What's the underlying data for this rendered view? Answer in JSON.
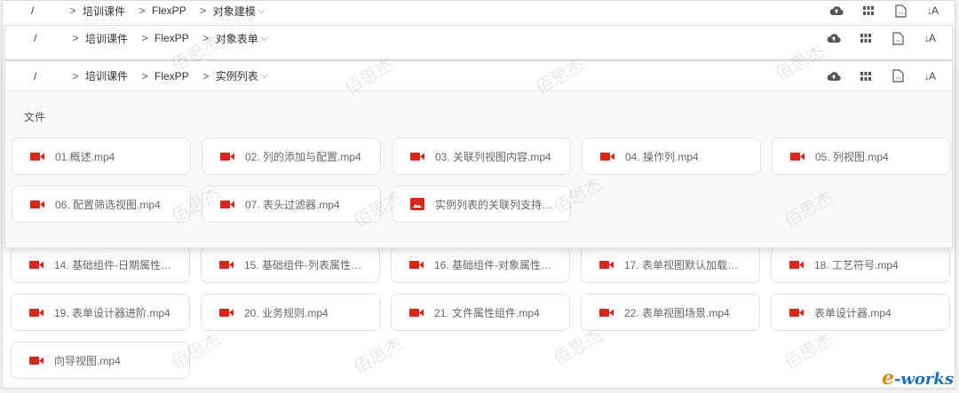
{
  "breadcrumb_root": "/",
  "panel1": {
    "crumbs": [
      "培训课件",
      "FlexPP"
    ],
    "current": "对象建模"
  },
  "panel2": {
    "crumbs": [
      "培训课件",
      "FlexPP"
    ],
    "current": "对象表单"
  },
  "panel3": {
    "crumbs": [
      "培训课件",
      "FlexPP"
    ],
    "current": "实例列表",
    "section": "文件"
  },
  "toolbar": {
    "upload_icon": "cloud-upload-icon",
    "grid_icon": "grid-view-icon",
    "file_icon": "file-icon",
    "sort_label": "↓A"
  },
  "files_top": [
    {
      "name": "01.概述.mp4",
      "type": "video"
    },
    {
      "name": "02. 列的添加与配置.mp4",
      "type": "video"
    },
    {
      "name": "03. 关联列视图内容.mp4",
      "type": "video"
    },
    {
      "name": "04. 操作列.mp4",
      "type": "video"
    },
    {
      "name": "05. 列视图.mp4",
      "type": "video"
    },
    {
      "name": "06. 配置筛选视图.mp4",
      "type": "video"
    },
    {
      "name": "07. 表头过滤器.mp4",
      "type": "video"
    },
    {
      "name": "实例列表的关联列支持…",
      "type": "image"
    }
  ],
  "files_bottom": [
    {
      "name": "14. 基础组件-日期属性…",
      "type": "video"
    },
    {
      "name": "15. 基础组件-列表属性…",
      "type": "video"
    },
    {
      "name": "16. 基础组件-对象属性…",
      "type": "video"
    },
    {
      "name": "17. 表单视图默认加载…",
      "type": "video"
    },
    {
      "name": "18. 工艺符号.mp4",
      "type": "video"
    },
    {
      "name": "19. 表单设计器进阶.mp4",
      "type": "video"
    },
    {
      "name": "20. 业务规则.mp4",
      "type": "video"
    },
    {
      "name": "21. 文件属性组件.mp4",
      "type": "video"
    },
    {
      "name": "22. 表单视图场景.mp4",
      "type": "video"
    },
    {
      "name": "表单设计器.mp4",
      "type": "video"
    },
    {
      "name": "向导视图.mp4",
      "type": "video"
    }
  ],
  "watermark": "佰思杰",
  "logo": {
    "e": "e",
    "rest": "-works"
  },
  "colors": {
    "video_icon": "#d9261c",
    "image_icon": "#d9261c",
    "logo": "#1f6fb8"
  }
}
